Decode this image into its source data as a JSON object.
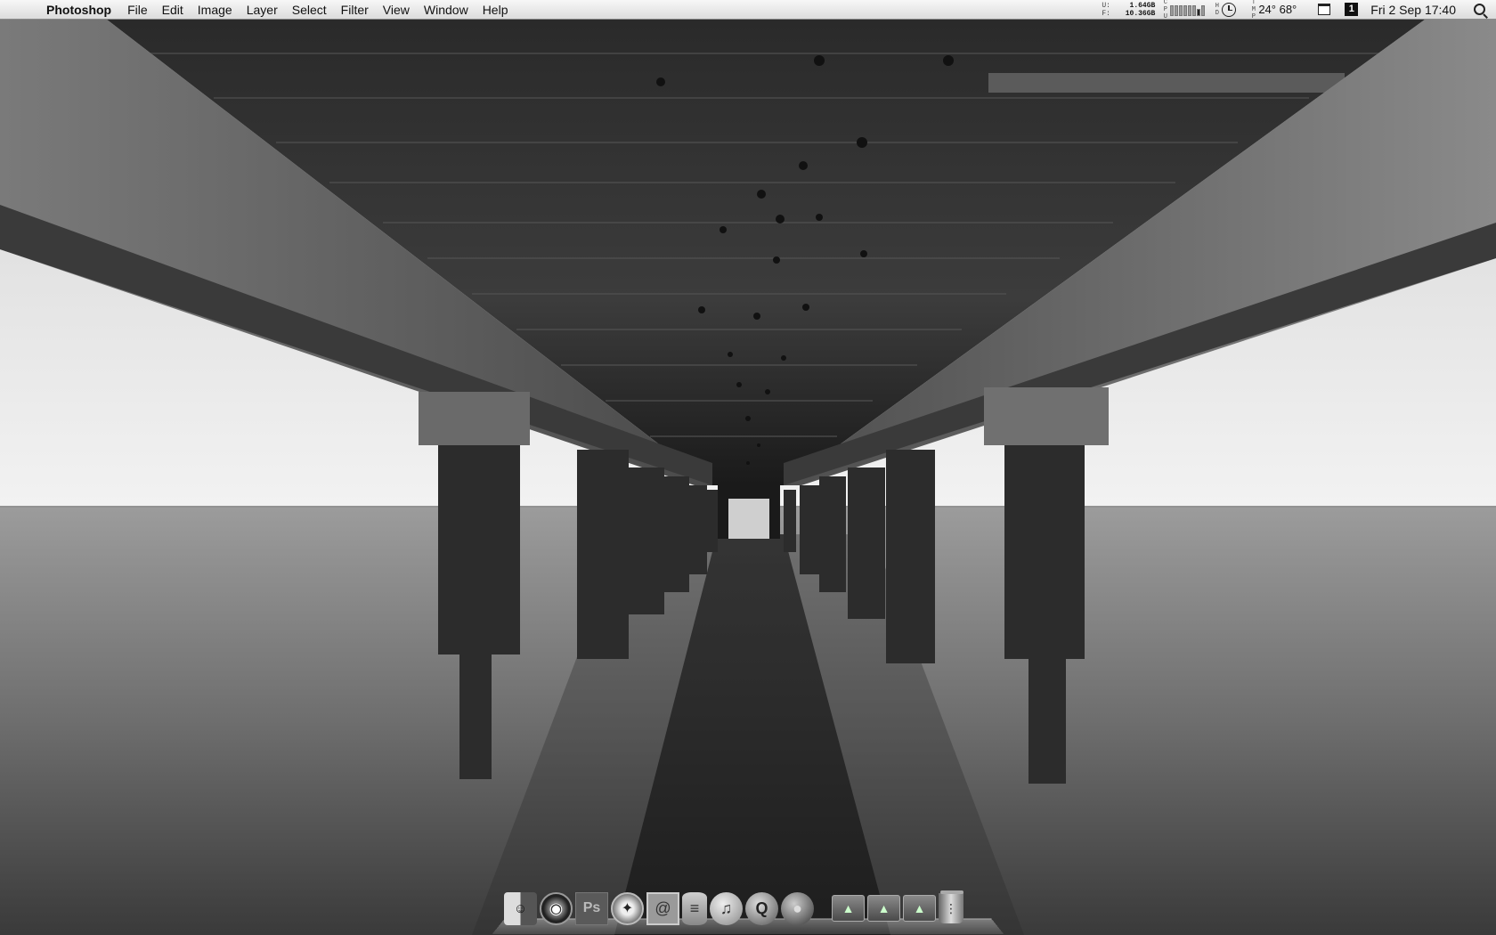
{
  "menubar": {
    "apple_icon": "apple-icon",
    "app_name": "Photoshop",
    "menus": [
      "File",
      "Edit",
      "Image",
      "Layer",
      "Select",
      "Filter",
      "View",
      "Window",
      "Help"
    ],
    "memory": {
      "used_key": "U:",
      "used_value": "1.64GB",
      "free_key": "F:",
      "free_value": "10.36GB"
    },
    "cpu_tag": [
      "C",
      "P",
      "U"
    ],
    "hd_tag": [
      "H",
      "D"
    ],
    "temp_tag": [
      "T",
      "M",
      "P"
    ],
    "temperature": "24° 68°",
    "space_number": "1",
    "datetime": "Fri 2 Sep  17:40"
  },
  "dock": {
    "items": [
      {
        "name": "finder",
        "icon": "finder-icon",
        "glyph": "☺"
      },
      {
        "name": "aperture",
        "icon": "aperture-icon",
        "glyph": "◉"
      },
      {
        "name": "photoshop",
        "icon": "photoshop-icon",
        "glyph": "Ps"
      },
      {
        "name": "safari",
        "icon": "safari-icon",
        "glyph": "✦"
      },
      {
        "name": "mail",
        "icon": "mail-icon",
        "glyph": "@"
      },
      {
        "name": "database",
        "icon": "database-icon",
        "glyph": "≡"
      },
      {
        "name": "itunes",
        "icon": "itunes-icon",
        "glyph": "♫"
      },
      {
        "name": "quicktime",
        "icon": "quicktime-icon",
        "glyph": "Q"
      },
      {
        "name": "firefox",
        "icon": "firefox-icon",
        "glyph": "●"
      },
      {
        "name": "folder-1",
        "icon": "folder-icon",
        "glyph": "▲"
      },
      {
        "name": "folder-2",
        "icon": "folder-icon",
        "glyph": "▲"
      },
      {
        "name": "folder-3",
        "icon": "folder-icon",
        "glyph": "▲"
      },
      {
        "name": "trash",
        "icon": "trash-icon",
        "glyph": "⋮"
      }
    ]
  }
}
